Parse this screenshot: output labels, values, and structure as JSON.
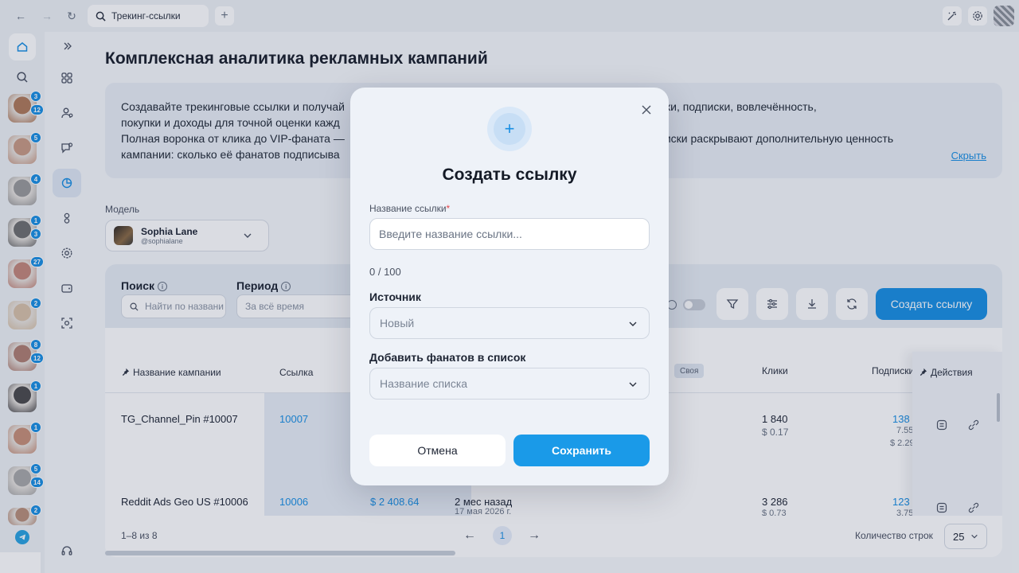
{
  "browser": {
    "tab_title": "Трекинг-ссылки"
  },
  "rail": {
    "models": [
      {
        "badges": [
          "3",
          "12"
        ],
        "color": "#b07a5a"
      },
      {
        "badges": [
          "5"
        ],
        "color": "#c99a84"
      },
      {
        "badges": [
          "4"
        ],
        "color": "#9a9a9a"
      },
      {
        "badges": [
          "1",
          "3"
        ],
        "color": "#6f6f6f"
      },
      {
        "badges": [
          "27"
        ],
        "color": "#c4877a"
      },
      {
        "badges": [
          "2"
        ],
        "color": "#d8c2a8"
      },
      {
        "badges": [
          "8",
          "12"
        ],
        "color": "#b07f72"
      },
      {
        "badges": [
          "1"
        ],
        "color": "#4c4a4c"
      },
      {
        "badges": [
          "1"
        ],
        "color": "#c78f78"
      },
      {
        "badges": [
          "5",
          "14"
        ],
        "color": "#a8a8a8"
      },
      {
        "badges": [
          "2"
        ],
        "color": "#b98f7a"
      }
    ]
  },
  "page": {
    "title": "Комплексная аналитика рекламных кампаний",
    "info_line1": "Создавайте трекинговые ссылки и получай",
    "info_line1_end": "слеживайте клики, подписки, вовлечённость,",
    "info_line2": "покупки и доходы для точной оценки кажд",
    "info_line3": "Полная воронка от клика до VIP-фаната —",
    "info_line3_end": "иски раскрывают дополнительную ценность",
    "info_line4": "кампании: сколько её фанатов подписыва",
    "hide_link": "Скрыть",
    "model_label": "Модель",
    "model_name": "Sophia Lane",
    "model_handle": "@sophialane"
  },
  "filters": {
    "search_label": "Поиск",
    "search_placeholder": "Найти по названи",
    "period_label": "Период",
    "period_value": "За всё время",
    "create_button": "Создать ссылку"
  },
  "table": {
    "headers": {
      "campaign": "Название кампании",
      "link": "Ссылка",
      "own_tag": "Своя",
      "clicks": "Клики",
      "subs": "Подписки",
      "actions": "Действия"
    },
    "rows": [
      {
        "name": "TG_Channel_Pin #10007",
        "link": "10007",
        "revenue": "",
        "date": "",
        "date_sub": "",
        "clicks": "1 840",
        "cpc": "$ 0.17",
        "subs": "138",
        "subs2": "7.55",
        "subs3": "$ 2.29"
      },
      {
        "name": "Reddit Ads Geo US #10006",
        "link": "10006",
        "revenue": "$ 2 408.64",
        "date": "2 мес назад",
        "date_sub": "17 мая 2026 г.",
        "clicks": "3 286",
        "cpc": "$ 0.73",
        "subs": "123",
        "subs2": "3.75",
        "subs3": ""
      }
    ]
  },
  "pager": {
    "summary": "1–8 из 8",
    "page": "1",
    "rows_label": "Количество строк",
    "rows_value": "25"
  },
  "modal": {
    "title": "Создать ссылку",
    "name_label": "Название ссылки",
    "name_required": "*",
    "name_placeholder": "Введите название ссылки...",
    "counter": "0 / 100",
    "source_label": "Источник",
    "source_value": "Новый",
    "list_label": "Добавить фанатов в список",
    "list_placeholder": "Название списка",
    "cancel": "Отмена",
    "save": "Сохранить"
  }
}
